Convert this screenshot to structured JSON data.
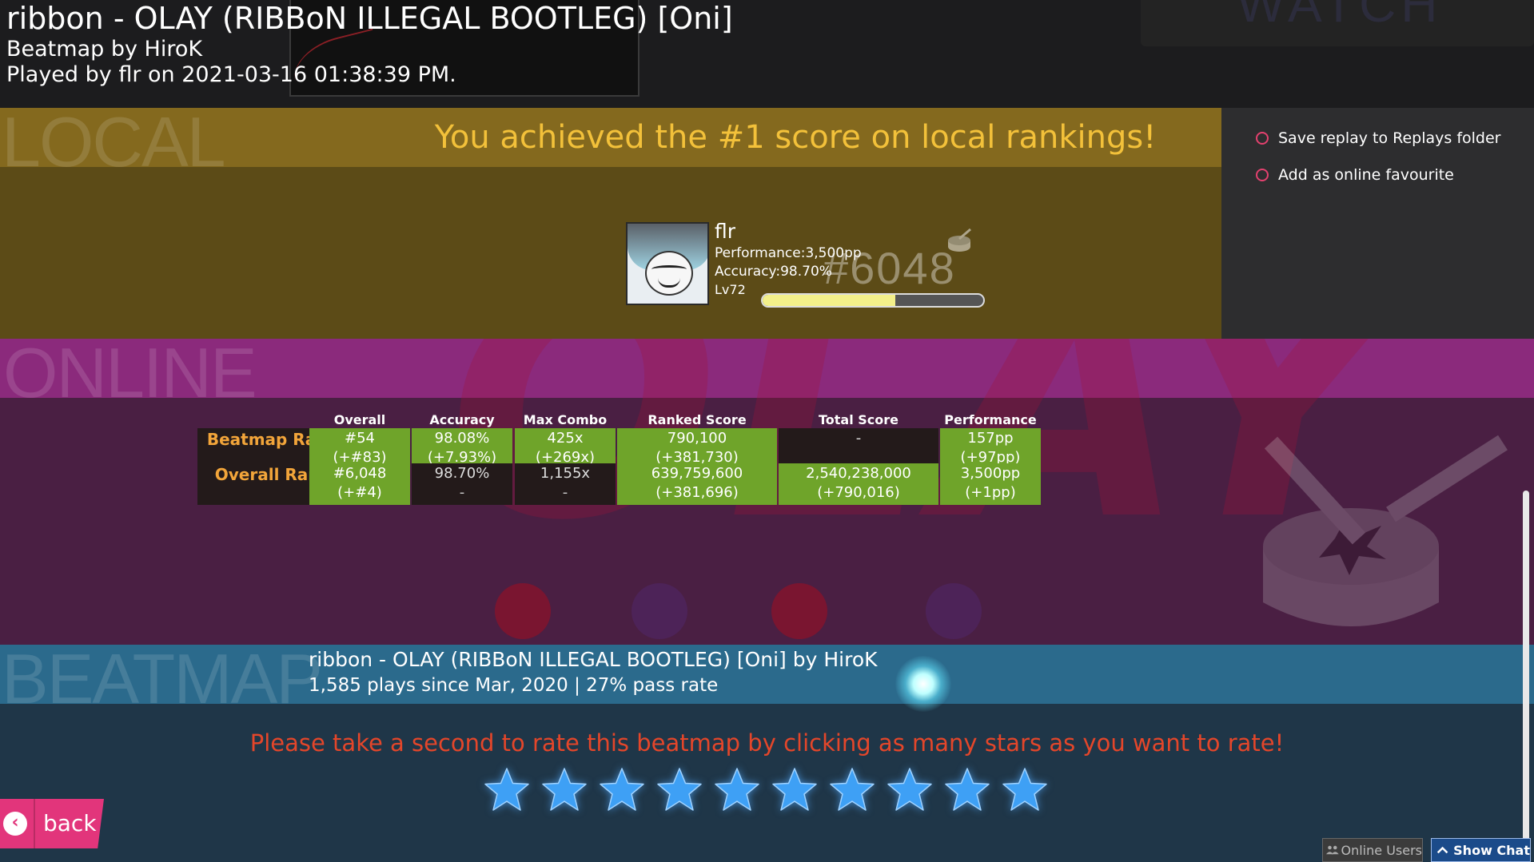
{
  "header": {
    "title": "ribbon - OLAY (RIBBoN ILLEGAL BOOTLEG) [Oni]",
    "mapper": "Beatmap by HiroK",
    "played": "Played by flr on 2021-03-16 01:38:39 PM."
  },
  "local": {
    "section_label": "LOCAL",
    "message": "You achieved the #1 score on local rankings!",
    "user": {
      "name": "flr",
      "performance": "Performance:3,500pp",
      "accuracy": "Accuracy:98.70%",
      "level": "Lv72",
      "rank": "#6048",
      "level_progress_percent": 60
    }
  },
  "options": {
    "save_replay": "Save replay to Replays folder",
    "online_favourite": "Add as online favourite"
  },
  "online": {
    "section_label": "ONLINE",
    "background_text": "OLAY",
    "columns": [
      "Overall",
      "Accuracy",
      "Max Combo",
      "Ranked Score",
      "Total Score",
      "Performance"
    ],
    "rows": [
      {
        "label": "Beatmap Ranking",
        "cells": [
          {
            "value": "#54",
            "delta": "(+#83)"
          },
          {
            "value": "98.08%",
            "delta": "(+7.93%)"
          },
          {
            "value": "425x",
            "delta": "(+269x)"
          },
          {
            "value": "790,100",
            "delta": "(+381,730)"
          },
          {
            "value": "-",
            "delta": ""
          },
          {
            "value": "157pp",
            "delta": "(+97pp)"
          }
        ]
      },
      {
        "label": "Overall Ranking",
        "cells": [
          {
            "value": "#6,048",
            "delta": "(+#4)"
          },
          {
            "value": "98.70%",
            "delta": "-"
          },
          {
            "value": "1,155x",
            "delta": "-"
          },
          {
            "value": "639,759,600",
            "delta": "(+381,696)"
          },
          {
            "value": "2,540,238,000",
            "delta": "(+790,016)"
          },
          {
            "value": "3,500pp",
            "delta": "(+1pp)"
          }
        ]
      }
    ]
  },
  "beatmap": {
    "section_label": "BEATMAP",
    "title": "ribbon - OLAY (RIBBoN ILLEGAL BOOTLEG) [Oni] by HiroK",
    "stats": "1,585 plays since Mar, 2020 | 27% pass rate",
    "rate_message": "Please take a second to rate this beatmap by clicking as many stars as you want to rate!",
    "star_count": 10
  },
  "footer": {
    "back": "back",
    "online_users": "Online Users",
    "show_chat": "Show Chat"
  },
  "colors": {
    "local_banner": "#84691e",
    "online_banner": "#8b2a7c",
    "beatmap_banner": "#2b6a8c",
    "stat_green": "#6fa42a",
    "back_pink": "#e2357b",
    "rate_orange": "#e4462a"
  }
}
